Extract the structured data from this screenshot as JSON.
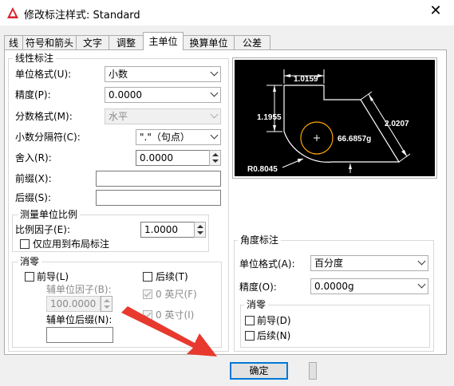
{
  "window": {
    "title": "修改标注样式: Standard",
    "close_icon": "close-icon"
  },
  "tabs": [
    "线",
    "符号和箭头",
    "文字",
    "调整",
    "主单位",
    "换算单位",
    "公差"
  ],
  "active_tab_index": 4,
  "linear": {
    "title": "线性标注",
    "unit_format_label": "单位格式(U):",
    "unit_format_value": "小数",
    "precision_label": "精度(P):",
    "precision_value": "0.0000",
    "fraction_format_label": "分数格式(M):",
    "fraction_format_value": "水平",
    "decimal_separator_label": "小数分隔符(C):",
    "decimal_separator_value": "\".\"（句点）",
    "round_off_label": "舍入(R):",
    "round_off_value": "0.0000",
    "prefix_label": "前缀(X):",
    "prefix_value": "",
    "suffix_label": "后缀(S):",
    "suffix_value": "",
    "scale": {
      "title": "测量单位比例",
      "factor_label": "比例因子(E):",
      "factor_value": "1.0000",
      "layout_only_label": "仅应用到布局标注"
    },
    "zero": {
      "title": "消零",
      "leading_label": "前导(L)",
      "sub_factor_label": "辅单位因子(B):",
      "sub_factor_value": "100.0000",
      "sub_suffix_label": "辅单位后缀(N):",
      "sub_suffix_value": "",
      "trailing_label": "后续(T)",
      "feet_label": "0 英尺(F)",
      "inches_label": "0 英寸(I)"
    }
  },
  "preview": {
    "dim_top": "1.0159",
    "dim_left": "1.1955",
    "dim_right": "2.0207",
    "dim_angle": "66.6857g",
    "dim_radius": "R0.8045",
    "background": "#000000",
    "geometry_color": "#ffffff",
    "circle_color": "#ffa500"
  },
  "angular": {
    "title": "角度标注",
    "unit_format_label": "单位格式(A):",
    "unit_format_value": "百分度",
    "precision_label": "精度(O):",
    "precision_value": "0.0000g",
    "zero": {
      "title": "消零",
      "leading_label": "前导(D)",
      "trailing_label": "后续(N)"
    }
  },
  "buttons": {
    "ok": "确定"
  },
  "annotation": {
    "arrow_color": "#e8392e"
  }
}
